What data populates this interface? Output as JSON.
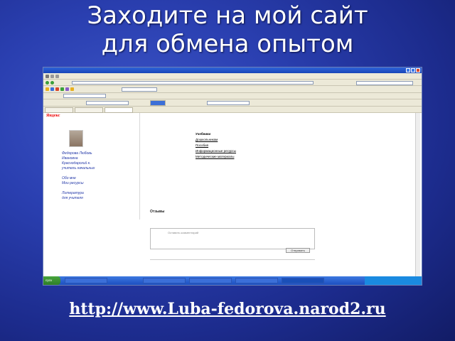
{
  "slide": {
    "title_line1": "Заходите на мой сайт",
    "title_line2": "для обмена опытом",
    "url": "http://www.Luba-fedorova.narod2.ru"
  },
  "browser": {
    "yandex_logo": "Яндекс",
    "left_links": [
      "Федорова Любовь",
      "Ивановна",
      "Краснодарский к.",
      "учитель начальных",
      "",
      "Обо мне",
      "Мои ресурсы",
      "",
      "Литература",
      "для учителя"
    ],
    "right_block": {
      "head": "Учебники",
      "items": [
        "Дошкольникам",
        "Пособия",
        "Информационные ресурсы",
        "Методические материалы"
      ]
    },
    "comments_title": "Отзывы",
    "comment_placeholder": "Оставить комментарий",
    "submit_label": "Отправить",
    "start_label": "пуск"
  },
  "colors": {
    "slide_bg": "#2a3fb0",
    "title": "#ffffff",
    "taskbar": "#1c4fc0",
    "link": "#2338a8"
  }
}
